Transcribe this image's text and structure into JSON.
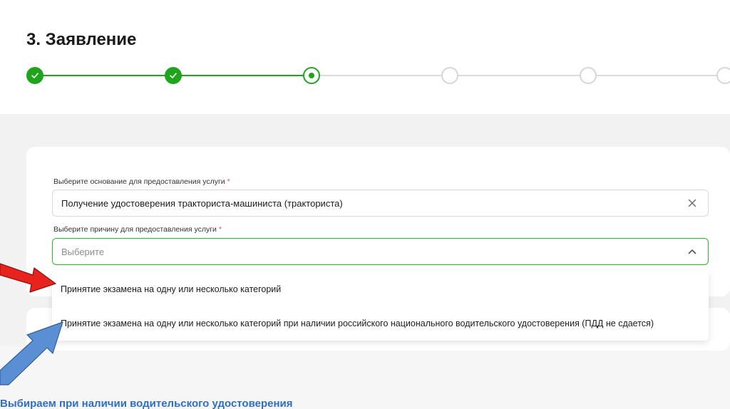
{
  "header": {
    "title": "3. Заявление"
  },
  "stepper": {
    "steps": [
      {
        "state": "done"
      },
      {
        "state": "done"
      },
      {
        "state": "current"
      },
      {
        "state": "todo"
      },
      {
        "state": "todo"
      },
      {
        "state": "todo"
      }
    ],
    "colors": {
      "done": "#1fa51b",
      "todo": "#dadada"
    }
  },
  "form": {
    "basis": {
      "label": "Выберите основание для предоставления услуги",
      "required_mark": "*",
      "value": "Получение удостоверения тракториста-машиниста (тракториста)",
      "clear_icon": "close-icon"
    },
    "reason": {
      "label": "Выберите причину для предоставления услуги",
      "required_mark": "*",
      "placeholder": "Выберите",
      "toggle_icon": "chevron-up-icon",
      "options": [
        "Принятие экзамена на одну или несколько категорий",
        "Принятие экзамена на одну или несколько категорий при наличии российского национального водительского удостоверения (ПДД не сдается)"
      ]
    }
  },
  "annotations": {
    "caption": "Выбираем при наличии водительского удостоверения",
    "red_arrow_icon": "red-arrow-icon",
    "blue_arrow_icon": "blue-arrow-icon",
    "caption_color": "#2f6fc4"
  }
}
